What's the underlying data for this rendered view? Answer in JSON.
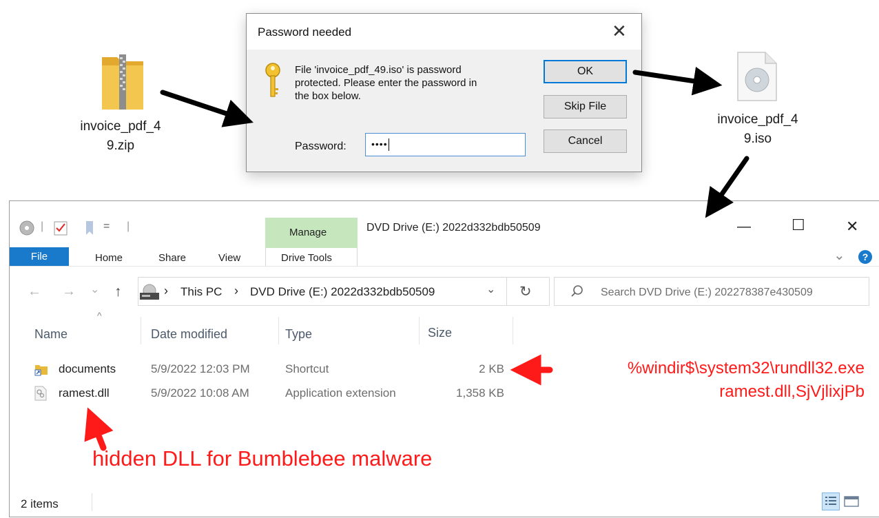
{
  "desktop": {
    "zip_file_label_line1": "invoice_pdf_4",
    "zip_file_label_line2": "9.zip",
    "iso_file_label_line1": "invoice_pdf_4",
    "iso_file_label_line2": "9.iso"
  },
  "dialog": {
    "title": "Password needed",
    "close_glyph": "✕",
    "message_line1": "File 'invoice_pdf_49.iso' is password",
    "message_line2": "protected.  Please enter the password in",
    "message_line3": "the box below.",
    "password_label": "Password:",
    "password_masked": "••••",
    "ok_label": "OK",
    "skip_label": "Skip File",
    "cancel_label": "Cancel"
  },
  "explorer": {
    "window_title": "DVD Drive (E:) 2022d332bdb50509",
    "qat_separator": "|",
    "qat_dropdown": "=",
    "tabs": {
      "file": "File",
      "home": "Home",
      "share": "Share",
      "view": "View",
      "manage": "Manage",
      "drive_tools": "Drive Tools"
    },
    "window_controls": {
      "minimize": "—",
      "maximize": "☐",
      "close": "✕"
    },
    "ribbon_expand": "⌄",
    "help": "?",
    "nav": {
      "back": "←",
      "forward": "→",
      "recent": "⌄",
      "up": "↑"
    },
    "breadcrumb": {
      "sep1": "›",
      "this_pc": "This PC",
      "sep2": "›",
      "drive": "DVD Drive (E:) 2022d332bdb50509",
      "dropdown": "⌄"
    },
    "refresh": "↻",
    "search_placeholder": "Search DVD Drive (E:) 202278387e430509",
    "sort_glyph": "^",
    "columns": {
      "name": "Name",
      "date": "Date modified",
      "type": "Type",
      "size": "Size"
    },
    "files": [
      {
        "name": "documents",
        "date": "5/9/2022 12:03 PM",
        "type": "Shortcut",
        "size": "2 KB"
      },
      {
        "name": "ramest.dll",
        "date": "5/9/2022 10:08 AM",
        "type": "Application extension",
        "size": "1,358 KB"
      }
    ],
    "status": "2 items"
  },
  "annotations": {
    "command_line1": "%windir$\\system32\\rundll32.exe",
    "command_line2": "ramest.dll,SjVjlixjPb",
    "hidden_dll": "hidden DLL for Bumblebee malware",
    "red": "#ff1a1a"
  },
  "colors": {
    "file_tab": "#1979ca",
    "manage_tab": "#c6e7bd",
    "ok_border": "#0078d7",
    "folder_yellow": "#f0c040",
    "arrow_black": "#000000"
  }
}
